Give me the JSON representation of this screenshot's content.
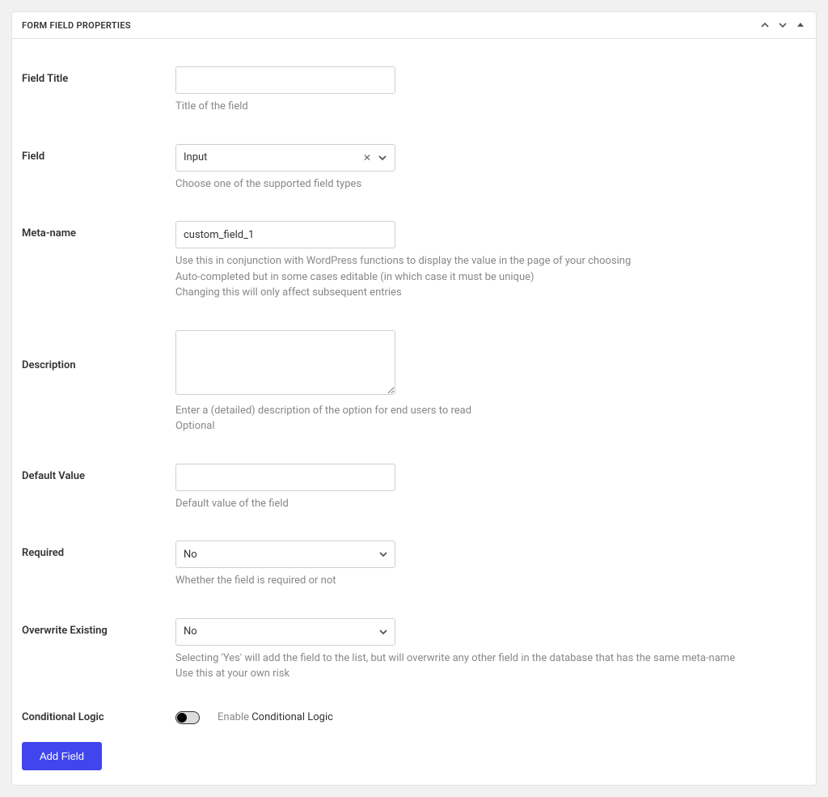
{
  "header": {
    "title": "FORM FIELD PROPERTIES"
  },
  "fields": {
    "title": {
      "label": "Field Title",
      "value": "",
      "help": "Title of the field"
    },
    "field": {
      "label": "Field",
      "value": "Input",
      "help": "Choose one of the supported field types"
    },
    "meta": {
      "label": "Meta-name",
      "value": "custom_field_1",
      "help1": "Use this in conjunction with WordPress functions to display the value in the page of your choosing",
      "help2": "Auto-completed but in some cases editable (in which case it must be unique)",
      "help3": "Changing this will only affect subsequent entries"
    },
    "desc": {
      "label": "Description",
      "value": "",
      "help1": "Enter a (detailed) description of the option for end users to read",
      "help2": "Optional"
    },
    "default": {
      "label": "Default Value",
      "value": "",
      "help": "Default value of the field"
    },
    "required": {
      "label": "Required",
      "value": "No",
      "help": "Whether the field is required or not"
    },
    "overwrite": {
      "label": "Overwrite Existing",
      "value": "No",
      "help1": "Selecting 'Yes' will add the field to the list, but will overwrite any other field in the database that has the same meta-name",
      "help2": "Use this at your own risk"
    },
    "conditional": {
      "label": "Conditional Logic",
      "enable_prefix": "Enable ",
      "enable_strong": "Conditional Logic"
    }
  },
  "button": {
    "add": "Add Field"
  }
}
